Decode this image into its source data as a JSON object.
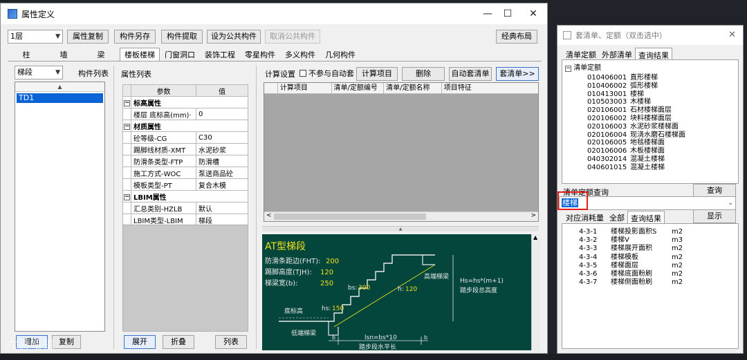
{
  "main_window": {
    "title": "属性定义",
    "controls": {
      "minimize": "—",
      "maximize": "☐",
      "close": "✕"
    }
  },
  "toolbar": {
    "floor_select": "1层",
    "buttons": [
      "属性复制",
      "构件另存",
      "构件提取",
      "设为公共构件",
      "取消公共构件"
    ],
    "classic_layout": "经典布局"
  },
  "tabs": [
    "柱",
    "墙",
    "梁",
    "楼板楼梯",
    "门窗洞口",
    "装饰工程",
    "零星构件",
    "多义构件",
    "几何构件"
  ],
  "component_panel": {
    "type_select": "梯段",
    "list_label": "构件列表",
    "items": [
      "TD1"
    ],
    "add_button": "增加",
    "copy_button": "复制"
  },
  "property_panel": {
    "label": "属性列表",
    "col_param": "参数",
    "col_value": "值",
    "groups": [
      {
        "name": "标高属性",
        "rows": [
          {
            "param": "楼层 底标高(mm)·",
            "value": "0"
          }
        ]
      },
      {
        "name": "材质属性",
        "rows": [
          {
            "param": "砼等级-CG",
            "value": "C30"
          },
          {
            "param": "踢脚线材质-XMT",
            "value": "水泥砂浆"
          },
          {
            "param": "防滑条类型-FTP",
            "value": "防滑槽"
          },
          {
            "param": "施工方式-WOC",
            "value": "泵送商品砼"
          },
          {
            "param": "模板类型-PT",
            "value": "复合木模"
          }
        ]
      },
      {
        "name": "LBIM属性",
        "rows": [
          {
            "param": "汇总类别-HZLB",
            "value": "默认"
          },
          {
            "param": "LBIM类型-LBIM",
            "value": "梯段"
          }
        ]
      }
    ],
    "expand_button": "展开",
    "collapse_button": "折叠",
    "table_button": "列表"
  },
  "calc_panel": {
    "label": "计算设置",
    "no_auto_checkbox": "不参与自动套",
    "calc_items_button": "计算项目",
    "delete_button": "删除",
    "auto_bill_button": "自动套清单",
    "bill_button": "套清单>>",
    "columns": [
      "计算项目",
      "清单/定额编号",
      "清单/定额名称",
      "项目特征"
    ]
  },
  "diagram": {
    "title": "AT型梯段",
    "params": [
      {
        "label": "防滑条距边(FHT):",
        "value": "200"
      },
      {
        "label": "踢脚高度(TJH):",
        "value": "120"
      },
      {
        "label": "梯梁宽(b):",
        "value": "250"
      }
    ],
    "labels": {
      "bs": "bs:",
      "bs_val": "300",
      "hs": "hs:",
      "hs_val": "150",
      "h": "h:",
      "h_val": "120",
      "high_beam": "高端梯梁",
      "low_beam": "低端梯梁",
      "bottom_elev": "底标高",
      "formula": "Hs=hs*(m+1)",
      "total_height": "踏步段总高度",
      "lsn": "lsn=bs*10",
      "horizontal_length": "踏步段水平长",
      "b": "b"
    }
  },
  "right_panel": {
    "title": "套清单、定额（双击选中）",
    "tabs": [
      "清单定额",
      "外部清单",
      "查询结果"
    ],
    "tree_root": "清单定额",
    "items": [
      {
        "code": "010406001",
        "name": "直形楼梯"
      },
      {
        "code": "010406002",
        "name": "弧形楼梯"
      },
      {
        "code": "010413001",
        "name": "楼梯"
      },
      {
        "code": "010503003",
        "name": "木楼梯"
      },
      {
        "code": "020106001",
        "name": "石材楼梯面层"
      },
      {
        "code": "020106002",
        "name": "块料楼梯面层"
      },
      {
        "code": "020106003",
        "name": "水泥砂浆楼梯面"
      },
      {
        "code": "020106004",
        "name": "现浇水磨石楼梯面"
      },
      {
        "code": "020106005",
        "name": "地毯楼梯面"
      },
      {
        "code": "020106006",
        "name": "木板楼梯面"
      },
      {
        "code": "040302014",
        "name": "混凝土楼梯"
      },
      {
        "code": "040601015",
        "name": "混凝土楼梯"
      }
    ],
    "query_label": "清单定额查询",
    "query_button": "查询",
    "query_value": "楼梯",
    "bottom_tabs": [
      "对应消耗量",
      "全部",
      "查询结果"
    ],
    "display_button": "显示",
    "results": [
      {
        "code": "4-3-1",
        "name": "楼梯投影面积S",
        "unit": "m2"
      },
      {
        "code": "4-3-2",
        "name": "楼梯V",
        "unit": "m3"
      },
      {
        "code": "4-3-3",
        "name": "楼梯展开面积",
        "unit": "m2"
      },
      {
        "code": "4-3-4",
        "name": "楼梯模板",
        "unit": "m2"
      },
      {
        "code": "4-3-5",
        "name": "楼梯面层",
        "unit": "m2"
      },
      {
        "code": "4-3-6",
        "name": "楼梯底面粉刷",
        "unit": "m2"
      },
      {
        "code": "4-3-7",
        "name": "楼梯侧面粉刷",
        "unit": "m2"
      }
    ]
  },
  "watermark": "六腑暗镜"
}
